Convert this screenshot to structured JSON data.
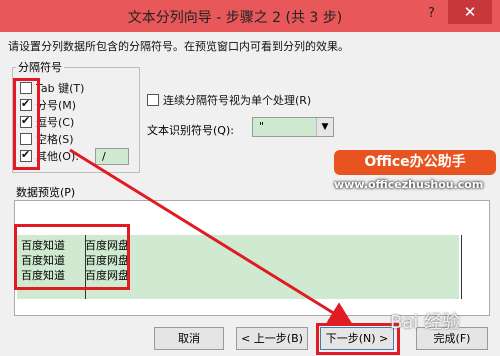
{
  "window": {
    "title": "文本分列向导 - 步骤之 2 (共 3 步)",
    "help_label": "?",
    "close_label": "✕"
  },
  "instruction": "请设置分列数据所包含的分隔符号。在预览窗口内可看到分列的效果。",
  "delimiters": {
    "group_title": "分隔符号",
    "items": [
      {
        "label": "Tab 键(T)",
        "checked": false
      },
      {
        "label": "分号(M)",
        "checked": true
      },
      {
        "label": "逗号(C)",
        "checked": true
      },
      {
        "label": "空格(S)",
        "checked": false
      },
      {
        "label": "其他(O):",
        "checked": true
      }
    ],
    "other_value": "/"
  },
  "consecutive": {
    "label": "连续分隔符号视为单个处理(R)",
    "checked": false
  },
  "text_qualifier": {
    "label": "文本识别符号(Q):",
    "value": "\""
  },
  "preview": {
    "label": "数据预览(P)",
    "rows": [
      [
        "百度知道",
        "百度网盘"
      ],
      [
        "百度知道",
        "百度网盘"
      ],
      [
        "百度知道",
        "百度网盘"
      ]
    ]
  },
  "buttons": {
    "cancel": "取消",
    "back": "< 上一步(B)",
    "next": "下一步(N) >",
    "finish": "完成(F)"
  },
  "brand": {
    "logo": "Office办公助手",
    "url": "www.officezhushou.com"
  },
  "watermark": "Bai 经验",
  "colors": {
    "titlebar": "#e8575a",
    "close": "#c7373c",
    "highlight": "#e01b22",
    "preview_green": "#cfead0"
  }
}
